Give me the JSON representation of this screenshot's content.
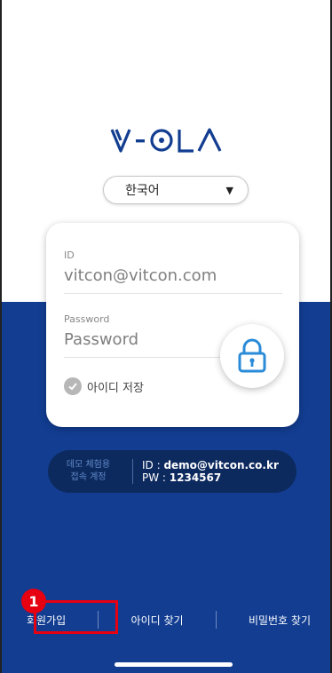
{
  "logo": {
    "text": "V-OLA"
  },
  "language": {
    "selected": "한국어",
    "caret_icon": "▼"
  },
  "login": {
    "id_label": "ID",
    "id_value": "vitcon@vitcon.com",
    "password_label": "Password",
    "password_placeholder": "Password",
    "remember_label": "아이디 저장"
  },
  "demo": {
    "title_line1": "데모 체험용",
    "title_line2": "접속 계정",
    "id_prefix": "ID : ",
    "id_value": "demo@vitcon.co.kr",
    "pw_prefix": "PW : ",
    "pw_value": "1234567"
  },
  "nav": {
    "signup": "회원가입",
    "find_id": "아이디 찾기",
    "find_password": "비밀번호 찾기"
  },
  "annotation": {
    "badge_number": "1"
  },
  "colors": {
    "brand_blue": "#123d91",
    "demo_bg": "#0d2a5e",
    "lock_blue": "#2a8bd8",
    "highlight_red": "#e60012"
  }
}
